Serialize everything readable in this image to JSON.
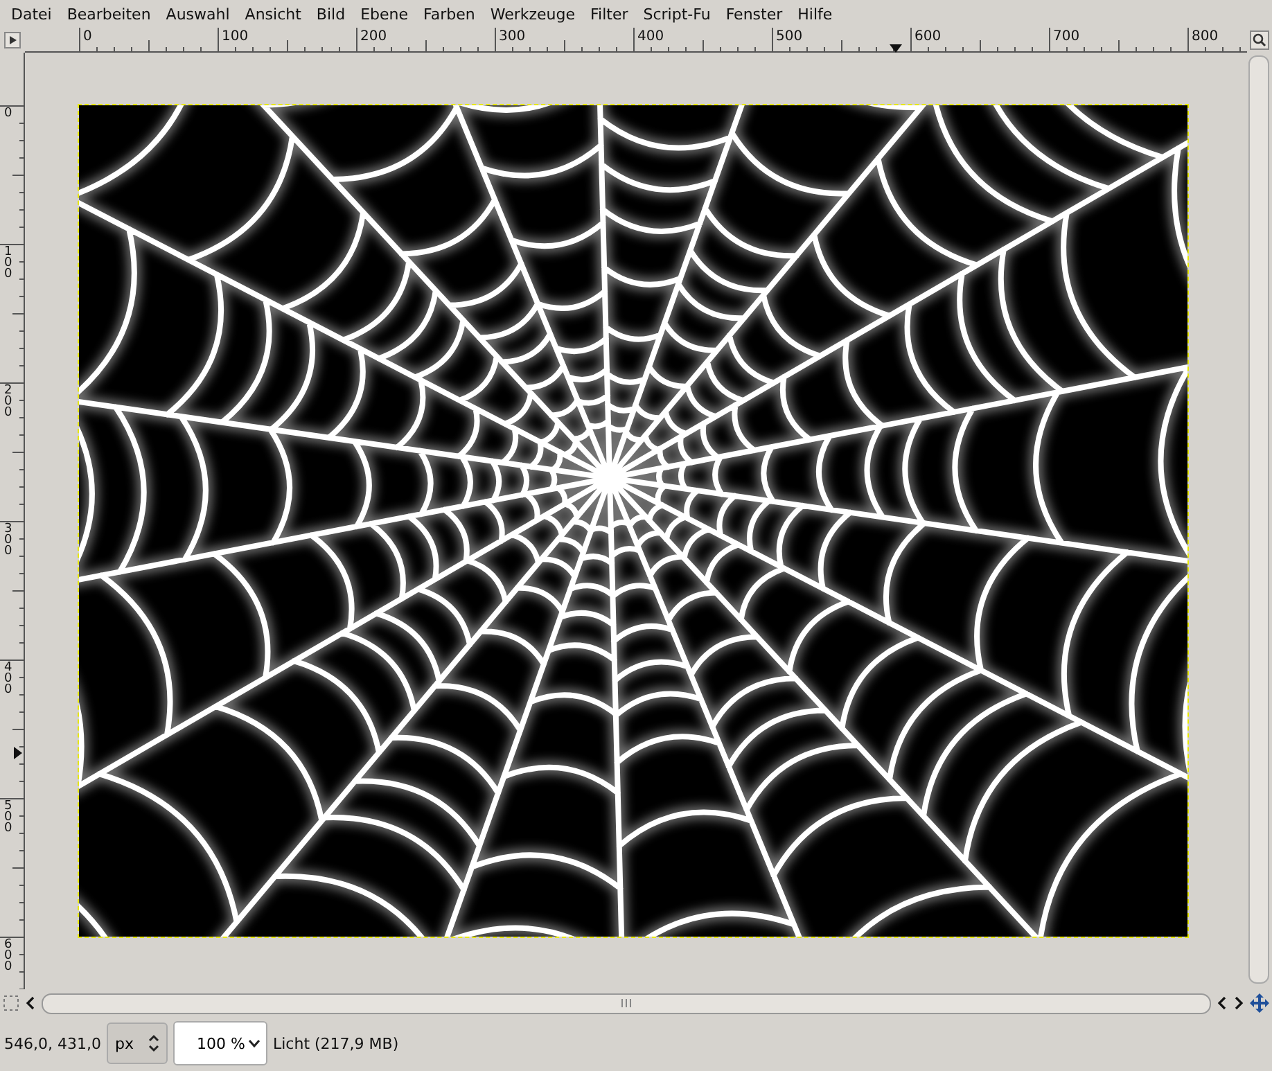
{
  "menu": [
    "Datei",
    "Bearbeiten",
    "Auswahl",
    "Ansicht",
    "Bild",
    "Ebene",
    "Farben",
    "Werkzeuge",
    "Filter",
    "Script-Fu",
    "Fenster",
    "Hilfe"
  ],
  "rulers": {
    "horizontal": [
      "0",
      "100",
      "200",
      "300",
      "400",
      "500",
      "600",
      "700",
      "800"
    ],
    "vertical": [
      "0",
      "100",
      "200",
      "300",
      "400",
      "500",
      "600"
    ]
  },
  "status": {
    "coordinates": "546,0, 431,0",
    "unit": "px",
    "zoom": "100 %",
    "layer_info": "Licht (217,9 MB)"
  }
}
